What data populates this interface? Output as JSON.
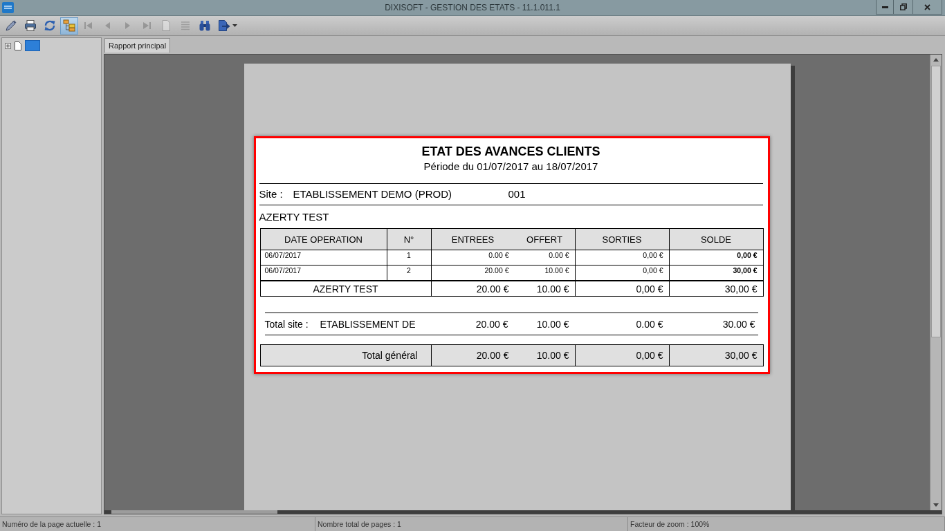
{
  "window": {
    "title": "DIXISOFT - GESTION DES ETATS - 11.1.011.1"
  },
  "toolbar": {
    "buttons": [
      {
        "kind": "edit",
        "disabled": false,
        "selected": false,
        "dropdown": false
      },
      {
        "kind": "print",
        "disabled": false,
        "selected": false,
        "dropdown": false
      },
      {
        "kind": "refresh",
        "disabled": false,
        "selected": false,
        "dropdown": false
      },
      {
        "kind": "tree",
        "disabled": false,
        "selected": true,
        "dropdown": false
      },
      {
        "kind": "first",
        "disabled": true,
        "selected": false,
        "dropdown": false
      },
      {
        "kind": "previous",
        "disabled": true,
        "selected": false,
        "dropdown": false
      },
      {
        "kind": "next",
        "disabled": true,
        "selected": false,
        "dropdown": false
      },
      {
        "kind": "last",
        "disabled": true,
        "selected": false,
        "dropdown": false
      },
      {
        "kind": "page",
        "disabled": true,
        "selected": false,
        "dropdown": false
      },
      {
        "kind": "list",
        "disabled": true,
        "selected": false,
        "dropdown": false
      },
      {
        "kind": "search",
        "disabled": false,
        "selected": false,
        "dropdown": false
      },
      {
        "kind": "export",
        "disabled": false,
        "selected": false,
        "dropdown": true
      }
    ]
  },
  "tree": {
    "nodes": [
      {
        "expanded": false,
        "selected": true
      }
    ]
  },
  "tabs": [
    {
      "label": "Rapport principal",
      "selected": true
    }
  ],
  "report": {
    "highlighted": true,
    "title": "ETAT DES AVANCES CLIENTS",
    "period": "Période du 01/07/2017 au 18/07/2017",
    "site": {
      "label": "Site :",
      "name": "ETABLISSEMENT DEMO (PROD)",
      "code": "001"
    },
    "client": "AZERTY TEST",
    "table": {
      "columns": [
        {
          "labels": [
            "DATE OPERATION"
          ]
        },
        {
          "labels": [
            "N°"
          ]
        },
        {
          "labels": [
            "ENTREES",
            "OFFERT"
          ]
        },
        {
          "labels": [
            "SORTIES"
          ]
        },
        {
          "labels": [
            "SOLDE"
          ]
        }
      ],
      "rows": [
        {
          "cells": [
            [
              "06/07/2017"
            ],
            [
              "1"
            ],
            [
              "0.00 €",
              "0.00 €"
            ],
            [
              "0,00 €"
            ],
            [
              "0,00 €"
            ]
          ]
        },
        {
          "cells": [
            [
              "06/07/2017"
            ],
            [
              "2"
            ],
            [
              "20.00 €",
              "10.00 €"
            ],
            [
              "0,00 €"
            ],
            [
              "30,00 €"
            ]
          ]
        }
      ],
      "subtotal": {
        "label": "AZERTY TEST",
        "cells": [
          [
            "20.00 €",
            "10.00 €"
          ],
          [
            "0,00 €"
          ],
          [
            "30,00 €"
          ]
        ]
      }
    },
    "site_total": {
      "label": "Total site :",
      "name": "ETABLISSEMENT DE",
      "values": [
        "20.00 €",
        "10.00 €",
        "0.00 €",
        "30.00 €"
      ]
    },
    "grand_total": {
      "label": "Total général",
      "cells": [
        [
          "20.00 €",
          "10.00 €"
        ],
        [
          "0,00 €"
        ],
        [
          "30,00 €"
        ]
      ]
    }
  },
  "status_bar": [
    "Numéro de la page actuelle : 1",
    "Nombre total de pages : 1",
    "Facteur de zoom : 100%"
  ]
}
